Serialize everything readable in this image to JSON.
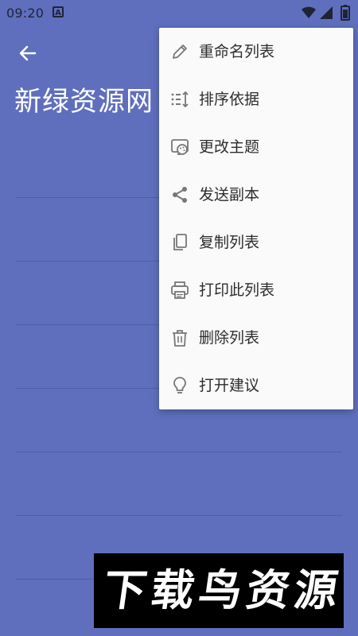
{
  "status_bar": {
    "time": "09:20",
    "notification_icon_letter": "A",
    "right_icons": [
      "wifi-icon",
      "signal-icon",
      "battery-icon"
    ]
  },
  "header": {
    "back_icon": "arrow-left-icon",
    "title": "新绿资源网"
  },
  "menu": {
    "items": [
      {
        "label": "重命名列表",
        "icon": "pencil-icon"
      },
      {
        "label": "排序依据",
        "icon": "sort-icon"
      },
      {
        "label": "更改主题",
        "icon": "theme-icon"
      },
      {
        "label": "发送副本",
        "icon": "share-icon"
      },
      {
        "label": "复制列表",
        "icon": "copy-icon"
      },
      {
        "label": "打印此列表",
        "icon": "print-icon"
      },
      {
        "label": "删除列表",
        "icon": "trash-icon"
      },
      {
        "label": "打开建议",
        "icon": "bulb-icon"
      }
    ]
  },
  "watermark": {
    "text": "下载鸟资源"
  },
  "colors": {
    "background": "#5f6fbd",
    "menu_background": "#fafafa",
    "text_dark": "#2d2d2d",
    "icon_gray": "#777777",
    "title_white": "#ffffff"
  }
}
